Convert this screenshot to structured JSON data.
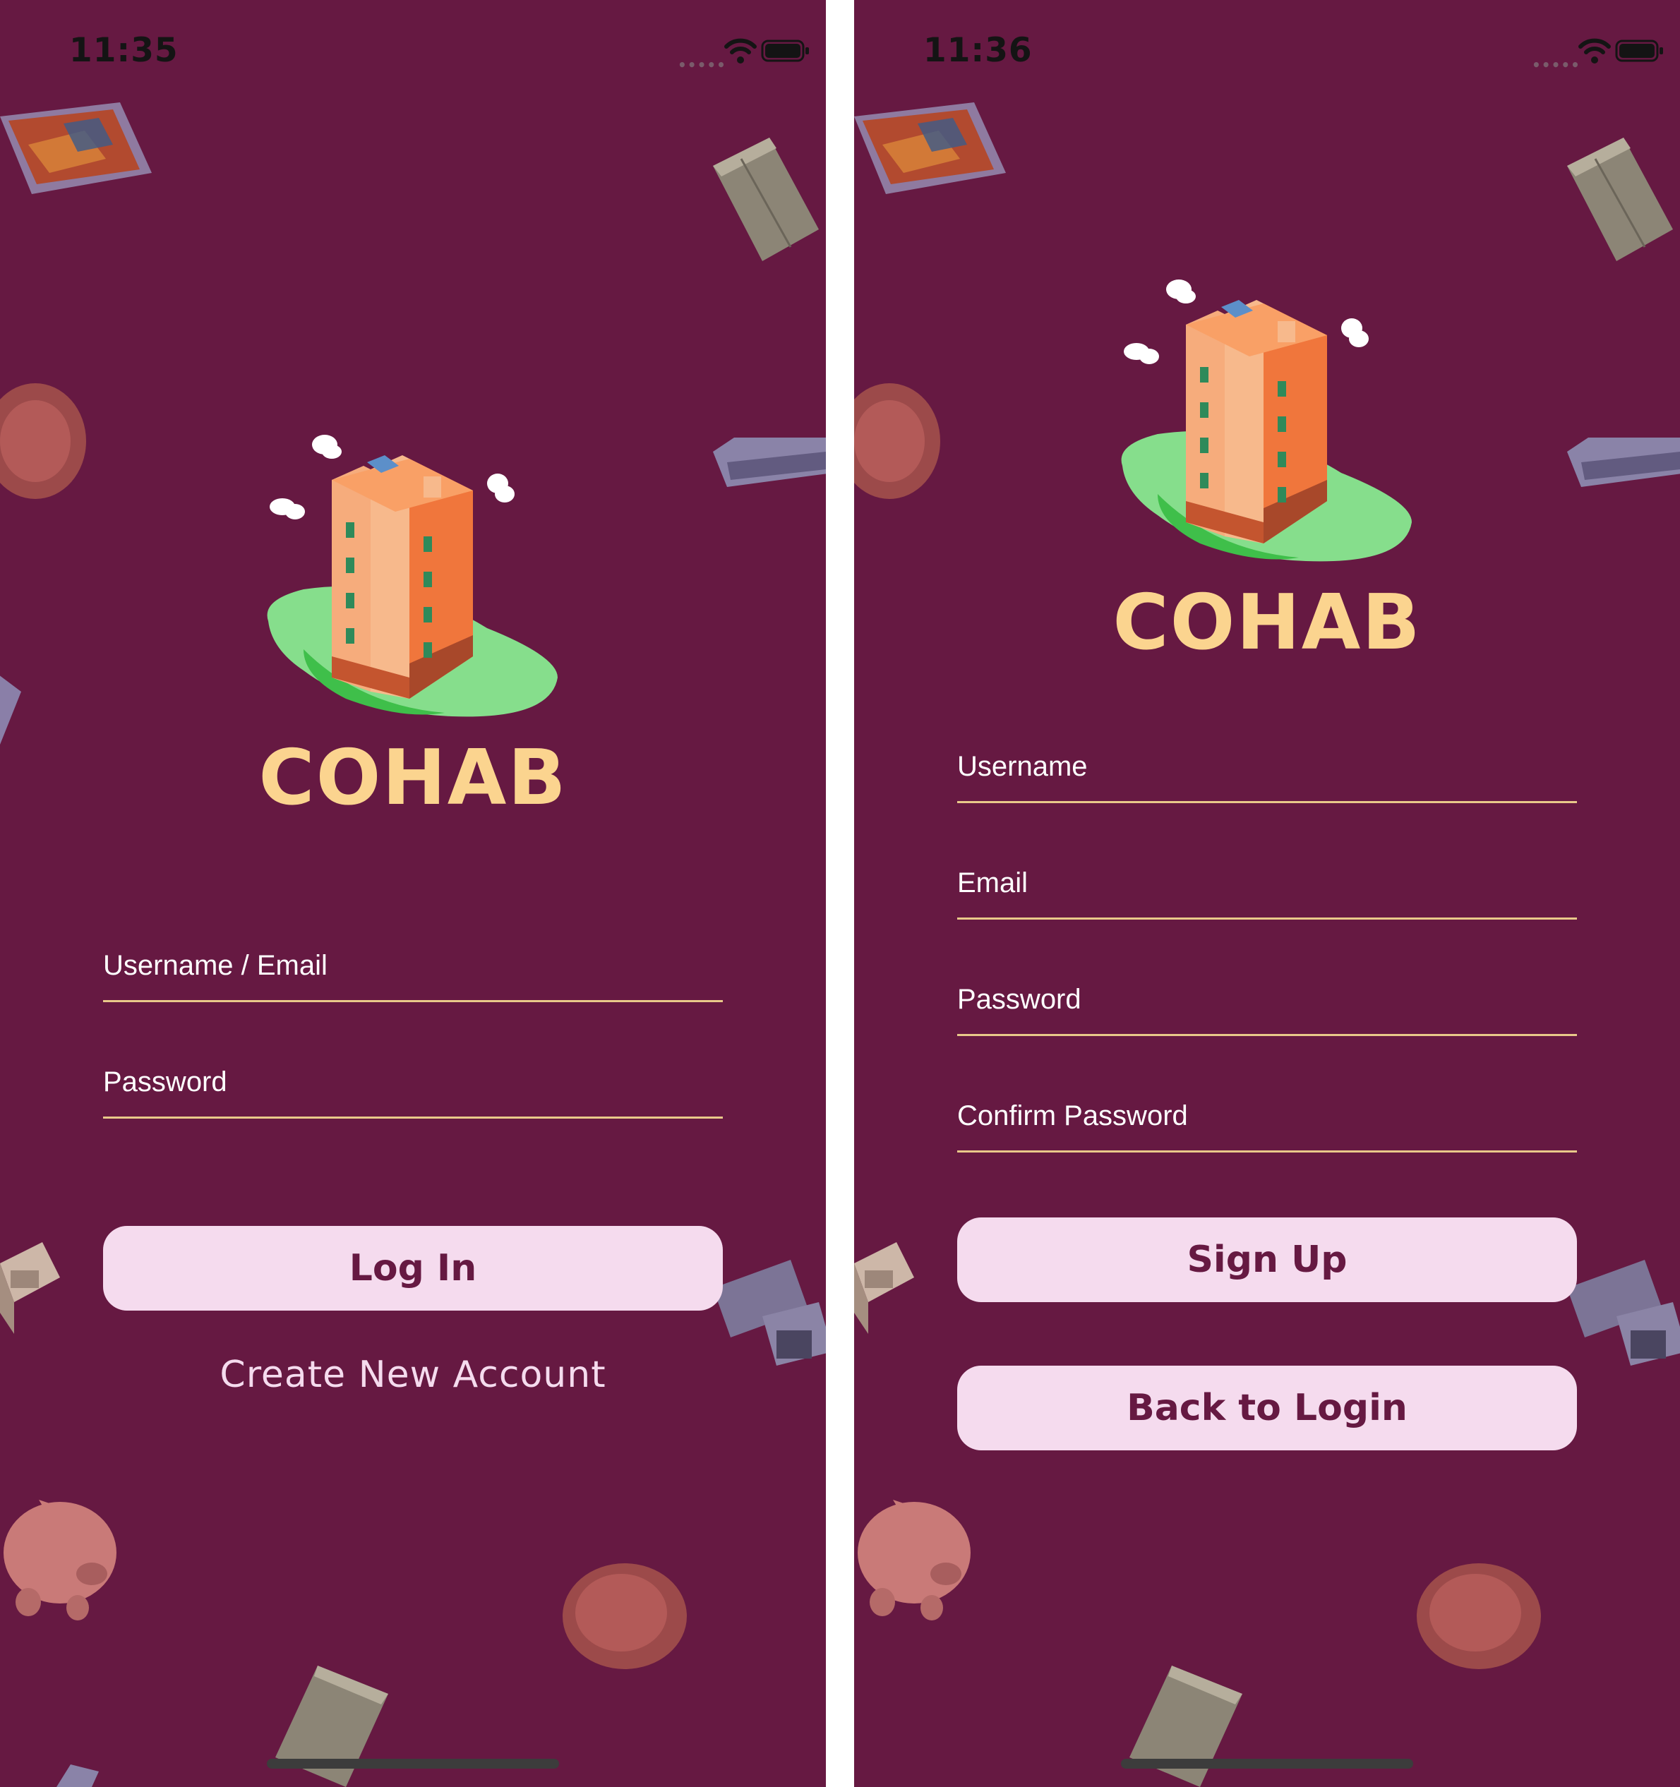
{
  "login": {
    "status_time": "11:35",
    "brand": "COHAB",
    "username_placeholder": "Username / Email",
    "password_placeholder": "Password",
    "login_button": "Log In",
    "create_account_link": "Create New Account"
  },
  "signup": {
    "status_time": "11:36",
    "brand": "COHAB",
    "username_placeholder": "Username",
    "email_placeholder": "Email",
    "password_placeholder": "Password",
    "confirm_password_placeholder": "Confirm Password",
    "signup_button": "Sign Up",
    "back_button": "Back to Login"
  },
  "colors": {
    "background": "#661942",
    "brand": "#fbd48f",
    "button_bg": "#f5dbee",
    "button_text": "#661942",
    "underline": "#e9c98a"
  },
  "icons": [
    "wifi-icon",
    "battery-icon",
    "building-logo-icon"
  ]
}
